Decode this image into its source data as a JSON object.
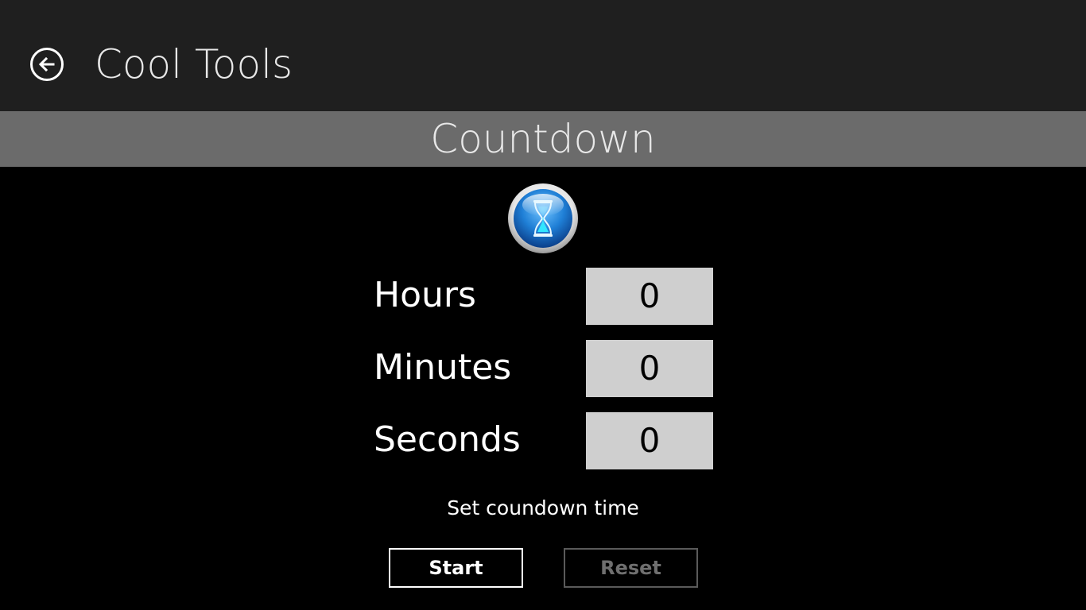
{
  "header": {
    "back_icon": "back-arrow-icon",
    "app_title": "Cool Tools"
  },
  "section": {
    "title": "Countdown",
    "icon": "hourglass-icon"
  },
  "fields": [
    {
      "label": "Hours",
      "value": "0"
    },
    {
      "label": "Minutes",
      "value": "0"
    },
    {
      "label": "Seconds",
      "value": "0"
    }
  ],
  "status": "Set coundown time",
  "buttons": {
    "start_label": "Start",
    "reset_label": "Reset",
    "reset_enabled": false
  },
  "colors": {
    "topbar": "#1f1f1f",
    "section_bar": "#6b6b6b",
    "background": "#000000",
    "field_bg": "#cfcfcf",
    "disabled": "#6f6f6f"
  }
}
